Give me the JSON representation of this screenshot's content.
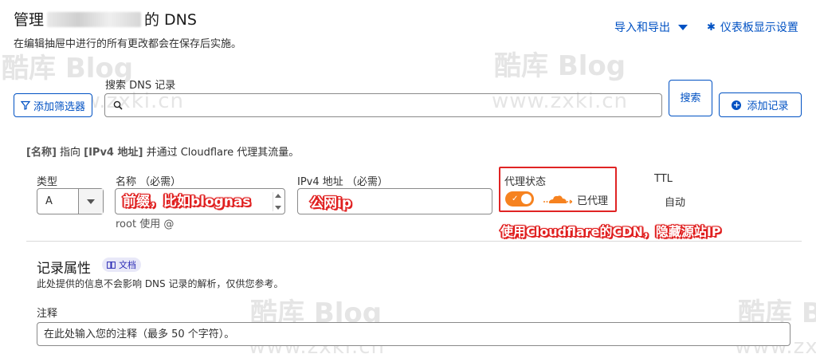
{
  "header": {
    "title_prefix": "管理",
    "title_suffix": "的 DNS",
    "subtitle": "在编辑抽屉中进行的所有更改都会在保存后实施。",
    "import_export": "导入和导出",
    "dashboard_settings": "仪表板显示设置"
  },
  "search": {
    "label": "搜索 DNS 记录",
    "placeholder": "",
    "filter_button": "添加筛选器",
    "search_button": "搜索",
    "add_record_button": "添加记录"
  },
  "info": {
    "name_tag": "[名称]",
    "text1": " 指向 ",
    "ipv4_tag": "[IPv4 地址]",
    "text2": " 并通过 Cloudflare 代理其流量。"
  },
  "form": {
    "type_label": "类型",
    "type_value": "A",
    "name_label": "名称 （必需）",
    "name_hint": "root 使用 @",
    "ipv4_label": "IPv4 地址 （必需）",
    "proxy_label": "代理状态",
    "proxy_value": "已代理",
    "ttl_label": "TTL",
    "ttl_value": "自动"
  },
  "annotations": {
    "prefix": "前缀，比如blognas",
    "ip": "公网ip",
    "cdn": "使用Cloudflare的CDN，隐藏源站IP"
  },
  "attributes": {
    "title": "记录属性",
    "doc_badge": "文档",
    "description": "此处提供的信息不会影响 DNS 记录的解析，仅供您参考。",
    "comment_label": "注释",
    "comment_placeholder": "在此处输入您的注释（最多 50 个字符）。"
  },
  "watermark": {
    "brand": "酷库 Blog",
    "url": "www.zxki.cn"
  },
  "colors": {
    "accent": "#0051c3",
    "proxy_orange": "#f6821f",
    "annotation_red": "#e02020"
  }
}
